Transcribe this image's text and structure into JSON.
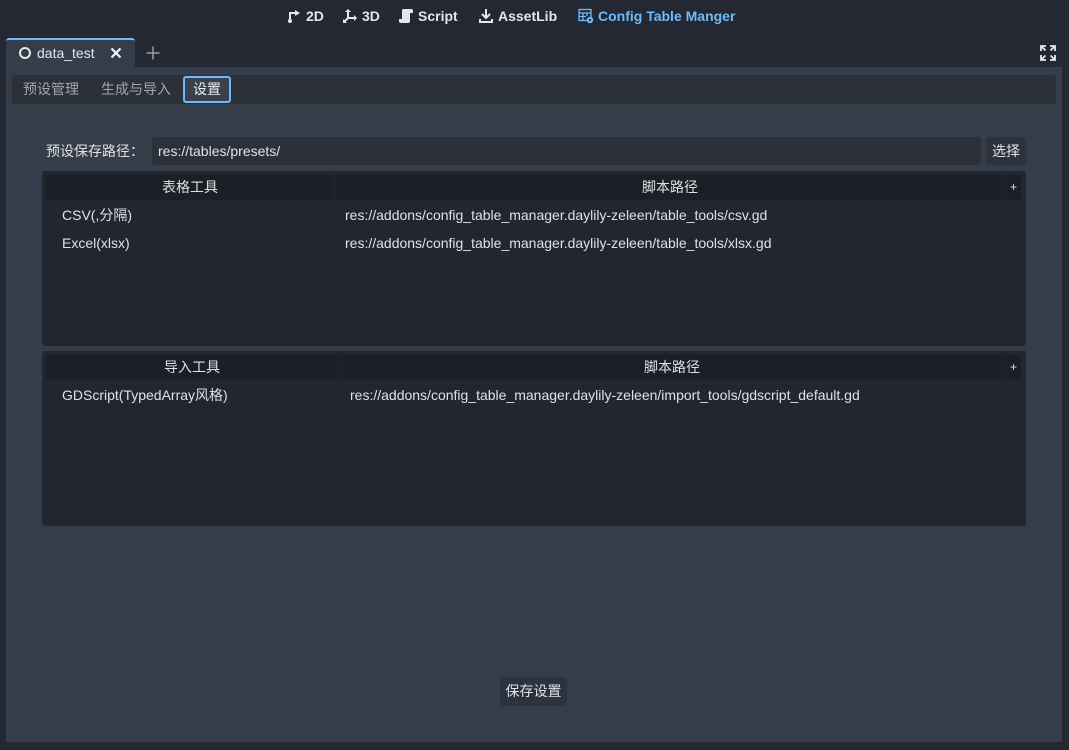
{
  "colors": {
    "accent": "#70bafa",
    "panel": "#363d4a",
    "editor_background": "#232833"
  },
  "main_screens": [
    {
      "label": "2D",
      "icon": "2d-icon"
    },
    {
      "label": "3D",
      "icon": "3d-icon"
    },
    {
      "label": "Script",
      "icon": "script-icon"
    },
    {
      "label": "AssetLib",
      "icon": "assetlib-icon"
    },
    {
      "label": "Config Table Manger",
      "icon": "table-icon",
      "active": true
    }
  ],
  "scene_tabs": [
    {
      "label": "data_test",
      "icon": "scene-circle-icon",
      "active": true
    }
  ],
  "plugin_tabs": [
    {
      "label": "预设管理"
    },
    {
      "label": "生成与导入"
    },
    {
      "label": "设置",
      "active": true
    }
  ],
  "settings": {
    "preset_path": {
      "label": "预设保存路径：",
      "value": "res://tables/presets/",
      "select_button": "选择"
    },
    "table_tools": {
      "columns": [
        "表格工具",
        "脚本路径"
      ],
      "add_button": "+",
      "rows": [
        {
          "name": "CSV(,分隔)",
          "path": "res://addons/config_table_manager.daylily-zeleen/table_tools/csv.gd"
        },
        {
          "name": "Excel(xlsx)",
          "path": "res://addons/config_table_manager.daylily-zeleen/table_tools/xlsx.gd"
        }
      ]
    },
    "import_tools": {
      "columns": [
        "导入工具",
        "脚本路径"
      ],
      "add_button": "+",
      "rows": [
        {
          "name": "GDScript(TypedArray风格)",
          "path": "res://addons/config_table_manager.daylily-zeleen/import_tools/gdscript_default.gd"
        }
      ]
    },
    "save_button": "保存设置"
  }
}
